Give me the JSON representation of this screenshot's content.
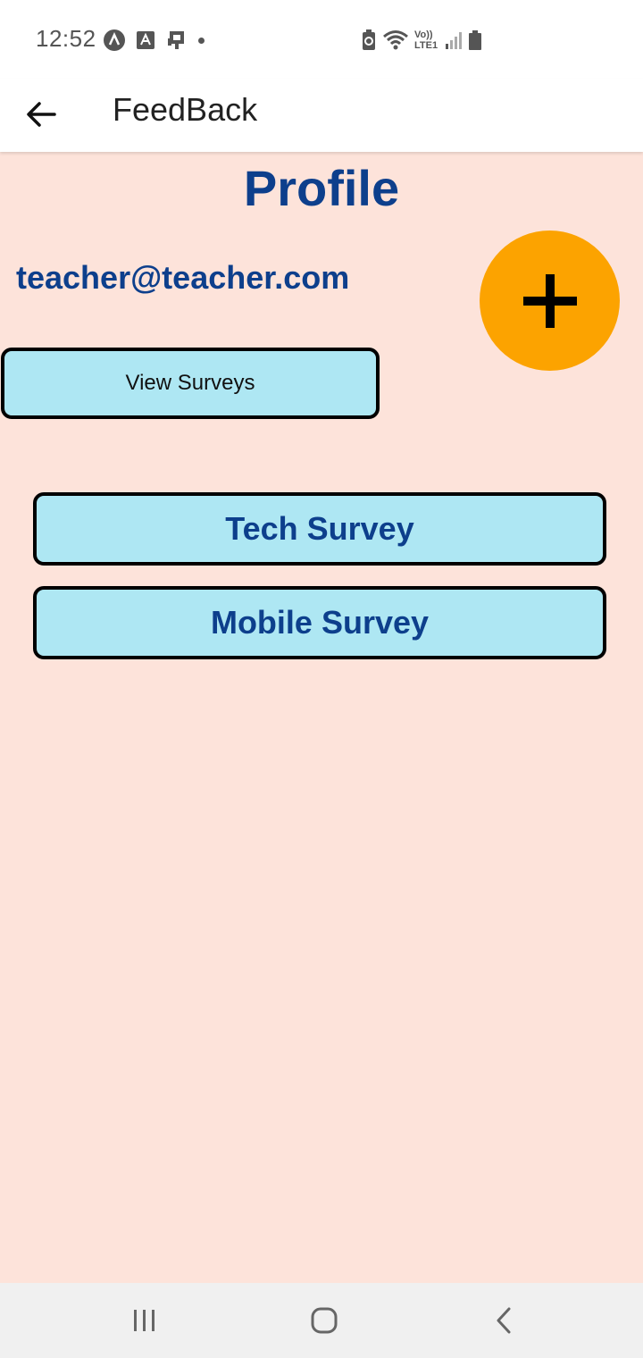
{
  "status_bar": {
    "time": "12:52",
    "network_label": "Vo)) LTE1",
    "icons": [
      "accessibility-icon",
      "translate-icon",
      "cast-icon",
      "notification-dot-icon",
      "battery-saver-icon",
      "wifi-icon",
      "signal-icon",
      "battery-icon"
    ]
  },
  "app_bar": {
    "title": "FeedBack",
    "back_icon": "arrow-left-icon"
  },
  "profile": {
    "title": "Profile",
    "email": "teacher@teacher.com",
    "add_icon": "plus-icon",
    "view_surveys_label": "View Surveys"
  },
  "surveys": [
    {
      "label": "Tech Survey"
    },
    {
      "label": "Mobile Survey"
    }
  ],
  "nav_bar": {
    "icons": [
      "recent-apps-icon",
      "home-icon",
      "back-icon"
    ]
  },
  "colors": {
    "background": "#fde3da",
    "title_text": "#0d3f8c",
    "button_fill": "#aee7f3",
    "fab": "#fca300"
  }
}
